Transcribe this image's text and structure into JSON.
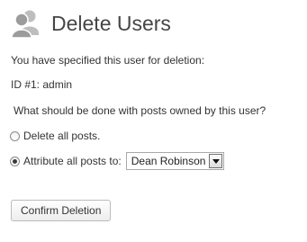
{
  "page": {
    "title": "Delete Users",
    "title_icon": "users-icon"
  },
  "intro_text": "You have specified this user for deletion:",
  "user_line": "ID #1: admin",
  "question_text": "What should be done with posts owned by this user?",
  "options": {
    "delete_label": "Delete all posts.",
    "delete_checked": false,
    "reassign_label": "Attribute all posts to:",
    "reassign_checked": true
  },
  "reassign_select": {
    "selected": "Dean Robinson"
  },
  "confirm_button_label": "Confirm Deletion",
  "colors": {
    "title": "#464646",
    "text": "#333333",
    "icon": "#a9a9a9"
  }
}
